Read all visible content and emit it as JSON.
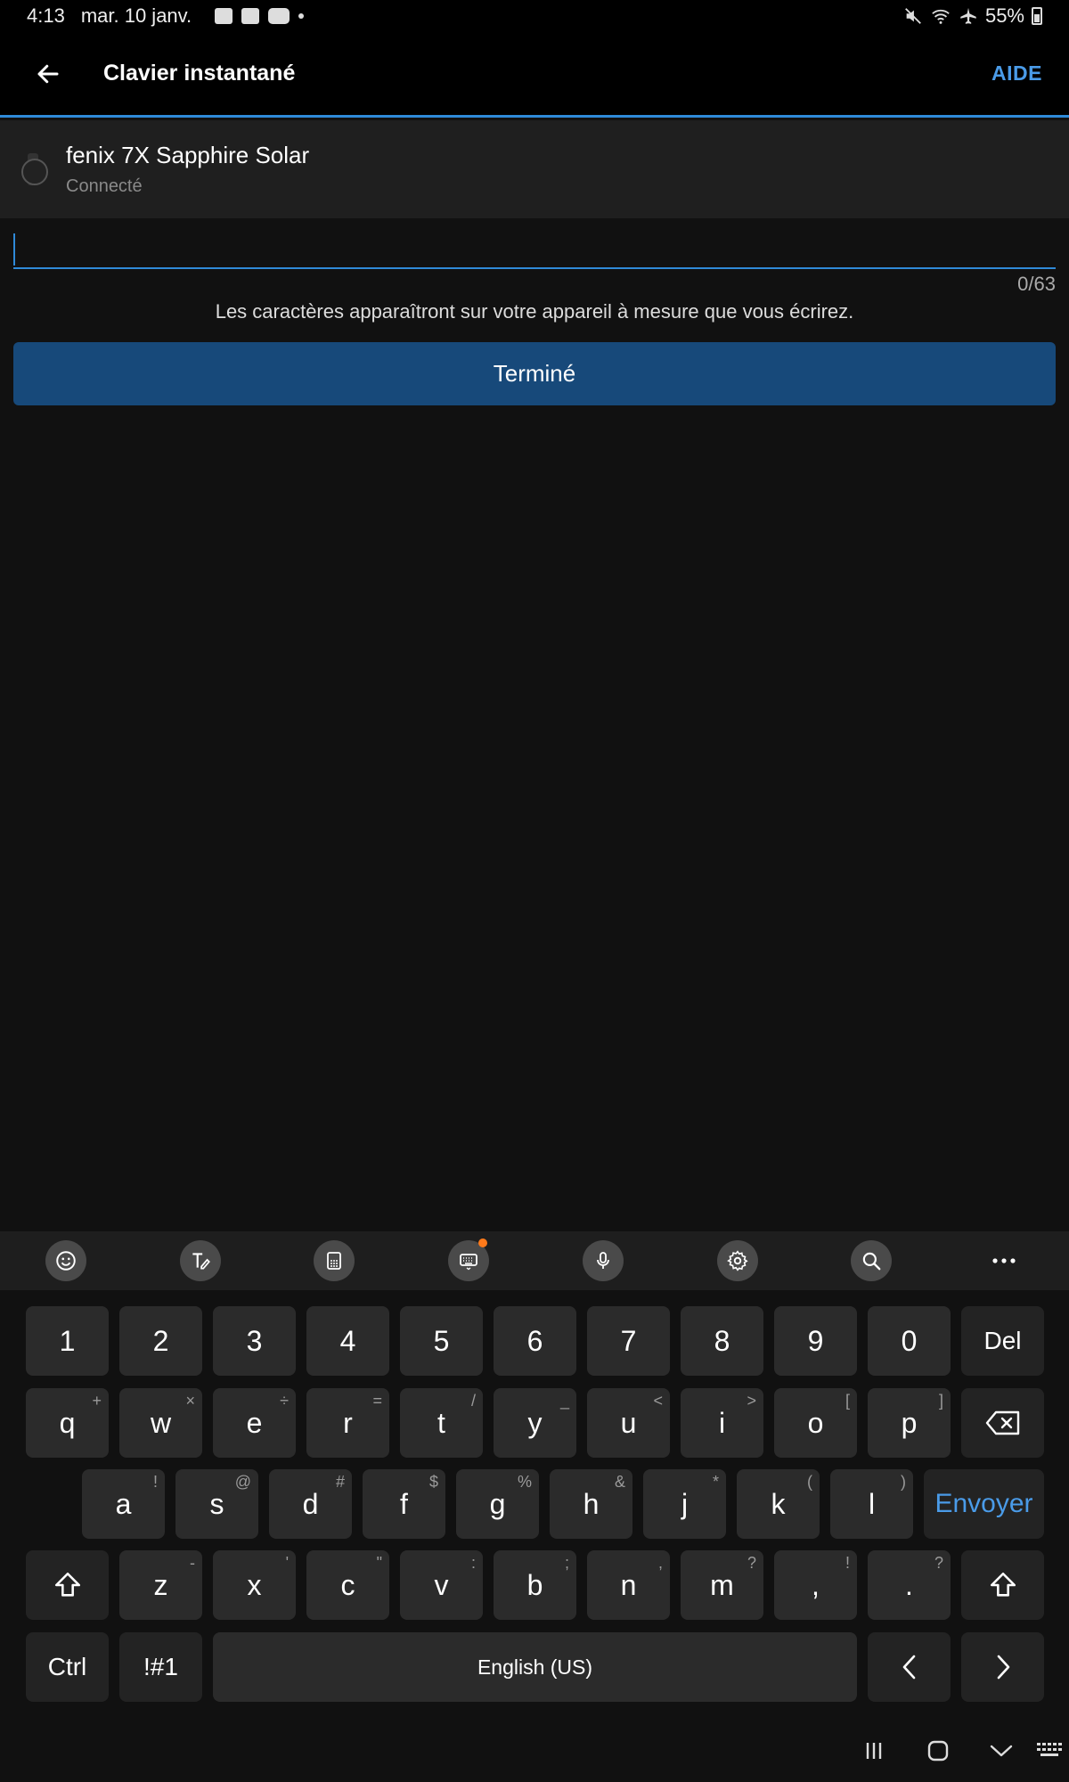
{
  "status_bar": {
    "time": "4:13",
    "date": "mar. 10 janv.",
    "battery": "55%"
  },
  "app_bar": {
    "title": "Clavier instantané",
    "help_label": "AIDE"
  },
  "device": {
    "name": "fenix 7X Sapphire Solar",
    "status": "Connecté"
  },
  "input": {
    "value": "",
    "counter": "0/63",
    "hint": "Les caractères apparaîtront sur votre appareil à mesure que vous écrirez."
  },
  "done_button": {
    "label": "Terminé"
  },
  "keyboard": {
    "number_row": [
      "1",
      "2",
      "3",
      "4",
      "5",
      "6",
      "7",
      "8",
      "9",
      "0"
    ],
    "del_label": "Del",
    "row1": [
      {
        "k": "q",
        "alt": "+"
      },
      {
        "k": "w",
        "alt": "×"
      },
      {
        "k": "e",
        "alt": "÷"
      },
      {
        "k": "r",
        "alt": "="
      },
      {
        "k": "t",
        "alt": "/"
      },
      {
        "k": "y",
        "alt": "_"
      },
      {
        "k": "u",
        "alt": "<"
      },
      {
        "k": "i",
        "alt": ">"
      },
      {
        "k": "o",
        "alt": "["
      },
      {
        "k": "p",
        "alt": "]"
      }
    ],
    "row2": [
      {
        "k": "a",
        "alt": "!"
      },
      {
        "k": "s",
        "alt": "@"
      },
      {
        "k": "d",
        "alt": "#"
      },
      {
        "k": "f",
        "alt": "$"
      },
      {
        "k": "g",
        "alt": "%"
      },
      {
        "k": "h",
        "alt": "&"
      },
      {
        "k": "j",
        "alt": "*"
      },
      {
        "k": "k",
        "alt": "("
      },
      {
        "k": "l",
        "alt": ")"
      }
    ],
    "enter_label": "Envoyer",
    "row3": [
      {
        "k": "z",
        "alt": "-"
      },
      {
        "k": "x",
        "alt": "'"
      },
      {
        "k": "c",
        "alt": "\""
      },
      {
        "k": "v",
        "alt": ":"
      },
      {
        "k": "b",
        "alt": ";"
      },
      {
        "k": "n",
        "alt": ","
      },
      {
        "k": "m",
        "alt": "?"
      },
      {
        "k": ",",
        "alt": "!"
      },
      {
        "k": ".",
        "alt": "?"
      }
    ],
    "ctrl_label": "Ctrl",
    "symbols_label": "!#1",
    "space_label": "English (US)"
  }
}
